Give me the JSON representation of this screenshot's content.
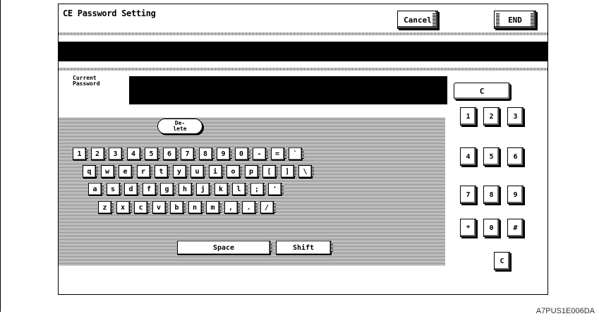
{
  "window": {
    "title": "CE Password Setting"
  },
  "header": {
    "cancel_label": "Cancel",
    "end_label": "END"
  },
  "password": {
    "label_line1": "Current",
    "label_line2": "Password",
    "clear_label": "C"
  },
  "keyboard": {
    "delete_line1": "De-",
    "delete_line2": "lete",
    "row1": [
      "1",
      "2",
      "3",
      "4",
      "5",
      "6",
      "7",
      "8",
      "9",
      "0",
      "-",
      "=",
      "`"
    ],
    "row2": [
      "q",
      "w",
      "e",
      "r",
      "t",
      "y",
      "u",
      "i",
      "o",
      "p",
      "[",
      "]",
      "\\"
    ],
    "row3": [
      "a",
      "s",
      "d",
      "f",
      "g",
      "h",
      "j",
      "k",
      "l",
      ";",
      "'"
    ],
    "row4": [
      "z",
      "x",
      "c",
      "v",
      "b",
      "n",
      "m",
      ",",
      ".",
      "/"
    ],
    "space_label": "Space",
    "shift_label": "Shift"
  },
  "tenkey": {
    "rows": [
      [
        "1",
        "2",
        "3"
      ],
      [
        "4",
        "5",
        "6"
      ],
      [
        "7",
        "8",
        "9"
      ],
      [
        "*",
        "0",
        "#"
      ]
    ],
    "clear_label": "C"
  },
  "figure_code": "A7PUS1E006DA"
}
